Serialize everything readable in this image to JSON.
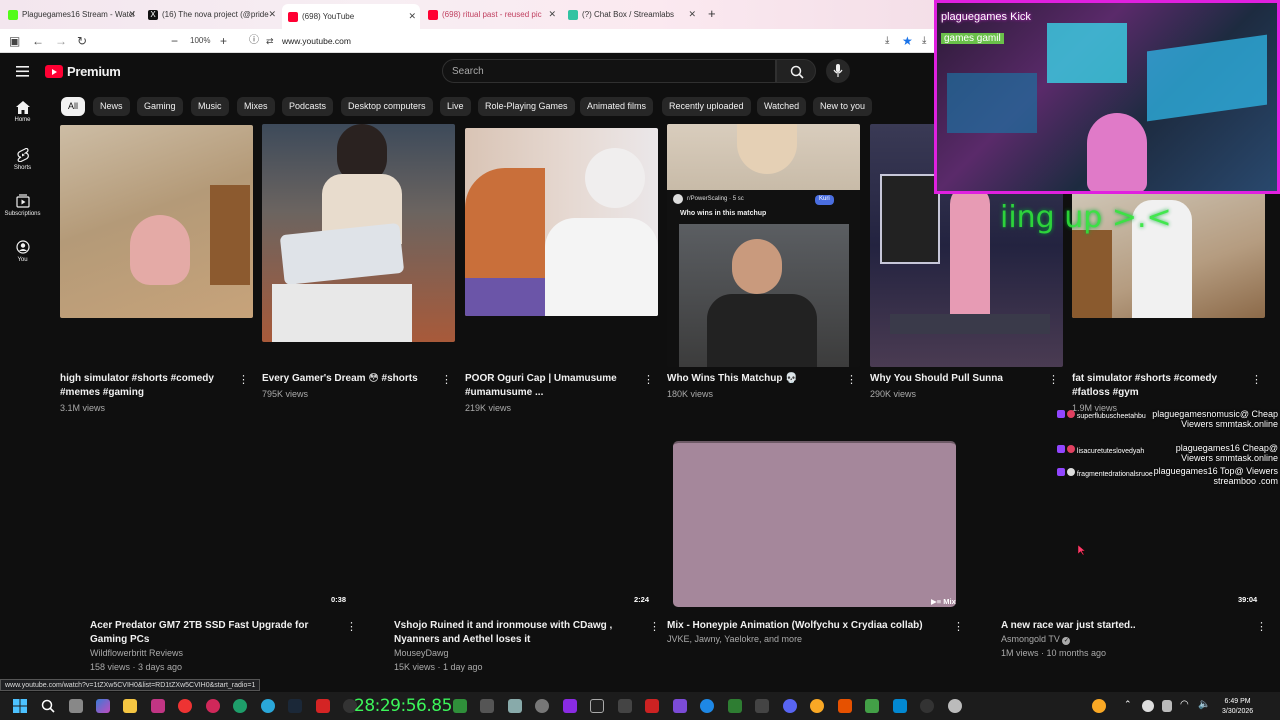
{
  "browser": {
    "tabs": [
      {
        "label": "Plaguegames16 Stream - Watch",
        "color": "#53fc18"
      },
      {
        "label": "(16) The nova project (@pride",
        "color": "#111111"
      },
      {
        "label": "(698) YouTube",
        "color": "#ff0033"
      },
      {
        "label": "(698) ritual past - reused pic",
        "color": "#ff0033"
      },
      {
        "label": "(?) Chat Box / Streamlabs",
        "color": "#31c3a2"
      }
    ],
    "zoom": "100%",
    "url": "www.youtube.com"
  },
  "youtube": {
    "logo_text": "Premium",
    "search_placeholder": "Search",
    "sidebar": [
      {
        "label": "Home",
        "icon": "home-icon"
      },
      {
        "label": "Shorts",
        "icon": "shorts-icon"
      },
      {
        "label": "Subscriptions",
        "icon": "subscriptions-icon"
      },
      {
        "label": "You",
        "icon": "you-icon"
      }
    ],
    "chips": [
      "All",
      "News",
      "Gaming",
      "Music",
      "Mixes",
      "Podcasts",
      "Desktop computers",
      "Live",
      "Role-Playing Games",
      "Animated films",
      "Recently uploaded",
      "Watched",
      "New to you"
    ],
    "shorts": [
      {
        "title": "high simulator #shorts #comedy #memes #gaming",
        "views": "3.1M views"
      },
      {
        "title": "Every Gamer's Dream 😳 #shorts",
        "views": "795K views"
      },
      {
        "title": "POOR Oguri Cap | Umamusume #umamusume ...",
        "views": "219K views"
      },
      {
        "title": "Who Wins This Matchup 💀",
        "views": "180K views"
      },
      {
        "title": "Why You Should Pull Sunna",
        "views": "290K views"
      },
      {
        "title": "fat simulator #shorts #comedy #fatloss #gym",
        "views": "1.9M views"
      }
    ],
    "short_overlay": {
      "channel": "r/PowerScaling",
      "time": "5 sc",
      "question": "Who wins in this matchup",
      "button": "Kuri"
    },
    "videos": [
      {
        "title": "Acer Predator GM7 2TB SSD Fast Upgrade for Gaming PCs",
        "channel": "Wildflowerbritt Reviews",
        "meta": "158 views · 3 days ago",
        "duration": "0:38"
      },
      {
        "title": "Vshojo Ruined it and ironmouse with CDawg , Nyanners and Aethel loses it",
        "channel": "MouseyDawg",
        "meta": "15K views · 1 day ago",
        "duration": "2:24"
      },
      {
        "title": "Mix - Honeypie Animation (Wolfychu x Crydiaa collab)",
        "channel": "JVKE, Jawny, Yaelokre, and more",
        "meta": "",
        "duration": "Mix"
      },
      {
        "title": "A new race war just started..",
        "channel": "Asmongold TV",
        "meta": "1M views · 10 months ago",
        "duration": "39:04"
      }
    ],
    "mix_thumb_color": "#a5879b"
  },
  "stream_overlay": {
    "webcam_caption": "plaguegames Kick",
    "webcam_caption2": "games gamil",
    "ring_text": "iing up >.<",
    "timer": "28:29:56.85",
    "chat": [
      {
        "user": "superflubuscheetahbu",
        "message": "plaguegamesnomusic@ Cheap Viewers smmtask.online"
      },
      {
        "user": "lisacuretuteslovedyah",
        "message": "plaguegames16 Cheap@ Viewers smmtask.online"
      },
      {
        "user": "fragmentedrationalsruoe",
        "message": "plaguegames16 Top@ Viewers streamboo .com"
      }
    ]
  },
  "status_url": "www.youtube.com/watch?v=1tZXw5CVIH0&list=RD1tZXw5CVIH0&start_radio=1",
  "taskbar": {
    "time": "6:49 PM",
    "date": "3/30/2026"
  }
}
